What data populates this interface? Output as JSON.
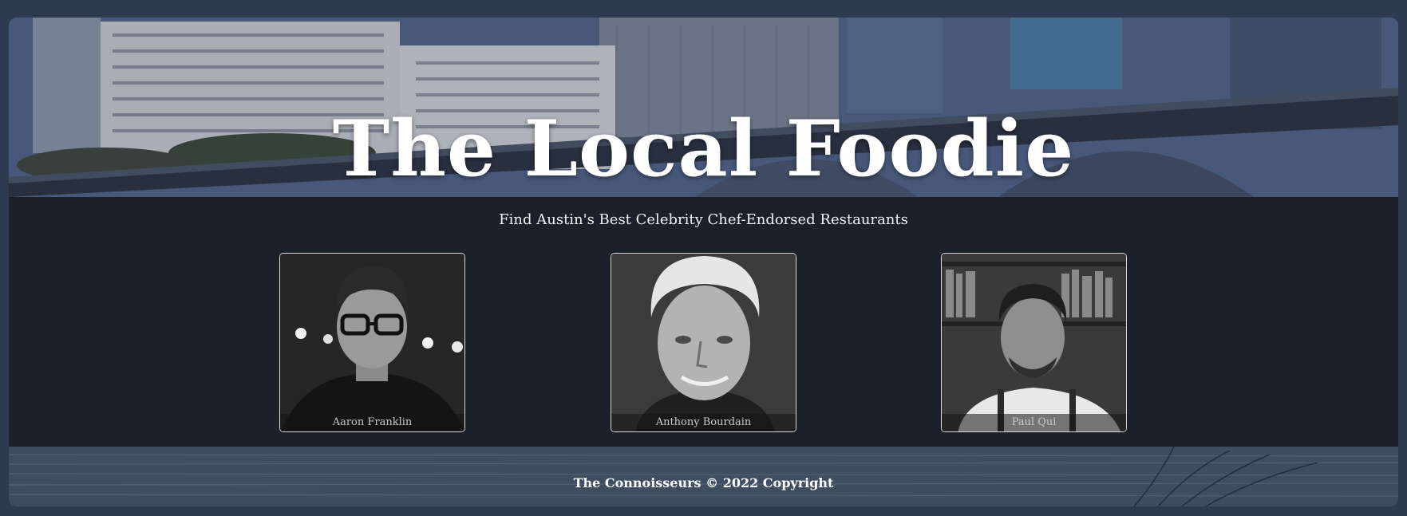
{
  "header": {
    "title": "The Local Foodie",
    "subtitle": "Find Austin's Best Celebrity Chef-Endorsed Restaurants"
  },
  "chefs": [
    {
      "name": "Aaron Franklin"
    },
    {
      "name": "Anthony Bourdain"
    },
    {
      "name": "Paul Qui"
    }
  ],
  "footer": {
    "text": "The Connoisseurs © 2022 Copyright"
  },
  "colors": {
    "page_border": "#2e3a4f",
    "body_background": "#1b202a",
    "title_text": "#ffffff"
  }
}
